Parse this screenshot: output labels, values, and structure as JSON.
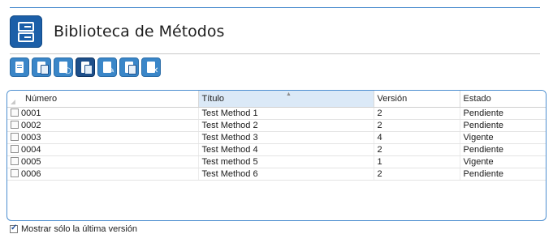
{
  "header": {
    "title": "Biblioteca de Métodos",
    "icon": "file-cabinet-icon"
  },
  "toolbar": {
    "buttons": [
      {
        "icon": "print-icon"
      },
      {
        "icon": "save-copy-icon"
      },
      {
        "icon": "view-document-icon"
      },
      {
        "icon": "import-document-icon",
        "active": true
      },
      {
        "icon": "edit-document-icon"
      },
      {
        "icon": "copy-document-icon"
      },
      {
        "icon": "delete-document-icon"
      }
    ]
  },
  "table": {
    "columns": [
      "Número",
      "Título",
      "Versión",
      "Estado"
    ],
    "sorted_column": "Título",
    "rows": [
      {
        "numero": "0001",
        "titulo": "Test Method 1",
        "version": "2",
        "estado": "Pendiente"
      },
      {
        "numero": "0002",
        "titulo": "Test Method 2",
        "version": "2",
        "estado": "Pendiente"
      },
      {
        "numero": "0003",
        "titulo": "Test Method 3",
        "version": "4",
        "estado": "Vigente"
      },
      {
        "numero": "0004",
        "titulo": "Test Method 4",
        "version": "2",
        "estado": "Pendiente"
      },
      {
        "numero": "0005",
        "titulo": "Test method 5",
        "version": "1",
        "estado": "Vigente"
      },
      {
        "numero": "0006",
        "titulo": "Test Method 6",
        "version": "2",
        "estado": "Pendiente"
      }
    ]
  },
  "footer": {
    "checkbox_label": "Mostrar sólo la última versión",
    "checked": true
  },
  "colors": {
    "accent": "#2b78c5",
    "icon_bg": "#3a86c8",
    "icon_active": "#1d4f8a"
  }
}
